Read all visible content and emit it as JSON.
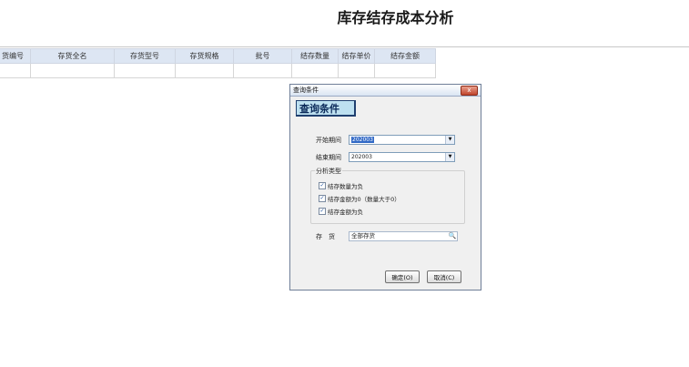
{
  "page_title": "库存结存成本分析",
  "table": {
    "headers": [
      "货编号",
      "存货全名",
      "存货型号",
      "存货规格",
      "批号",
      "结存数量",
      "结存单价",
      "结存金额"
    ]
  },
  "dialog": {
    "window_title": "查询条件",
    "close_label": "x",
    "heading": "查询条件",
    "start_period_label": "开始期间",
    "start_period_value": "202003",
    "end_period_label": "结束期间",
    "end_period_value": "202003",
    "analysis_group_label": "分析类型",
    "options": [
      {
        "label": "结存数量为负",
        "checked": true
      },
      {
        "label": "结存金额为0（数量大于0）",
        "checked": true
      },
      {
        "label": "结存金额为负",
        "checked": true
      }
    ],
    "inventory_label": "存　货",
    "inventory_value": "全部存货",
    "ok_label": "确定(O)",
    "cancel_label": "取消(C)"
  }
}
